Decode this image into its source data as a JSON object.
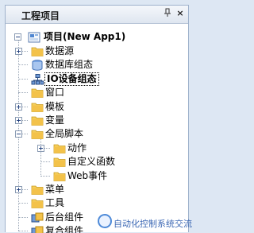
{
  "panel": {
    "title": "工程项目",
    "pin_glyph": "ㅁ",
    "close_glyph": "×"
  },
  "tree": {
    "root": "项目(New App1)",
    "items": [
      {
        "label": "数据源",
        "expander": "+",
        "icon": "folder-icon"
      },
      {
        "label": "数据库组态",
        "expander": "",
        "icon": "database-icon"
      },
      {
        "label": "IO设备组态",
        "expander": "",
        "icon": "network-icon",
        "selected": true
      },
      {
        "label": "窗口",
        "expander": "",
        "icon": "folder-icon"
      },
      {
        "label": "模板",
        "expander": "+",
        "icon": "folder-icon"
      },
      {
        "label": "变量",
        "expander": "+",
        "icon": "folder-icon"
      },
      {
        "label": "全局脚本",
        "expander": "−",
        "icon": "folder-icon"
      },
      {
        "label": "动作",
        "expander": "+",
        "icon": "folder-icon",
        "child": true
      },
      {
        "label": "自定义函数",
        "expander": "",
        "icon": "folder-icon",
        "child": true
      },
      {
        "label": "Web事件",
        "expander": "",
        "icon": "folder-icon",
        "child": true
      },
      {
        "label": "菜单",
        "expander": "+",
        "icon": "folder-icon"
      },
      {
        "label": "工具",
        "expander": "",
        "icon": "folder-icon"
      },
      {
        "label": "后台组件",
        "expander": "",
        "icon": "component-icon"
      },
      {
        "label": "复合组件",
        "expander": "",
        "icon": "component-icon"
      }
    ]
  },
  "watermark": {
    "text": "自动化控制系统交流"
  },
  "colors": {
    "selection_outline": "#000000",
    "folder": "#f3c24a",
    "accent": "#3c68b4"
  }
}
